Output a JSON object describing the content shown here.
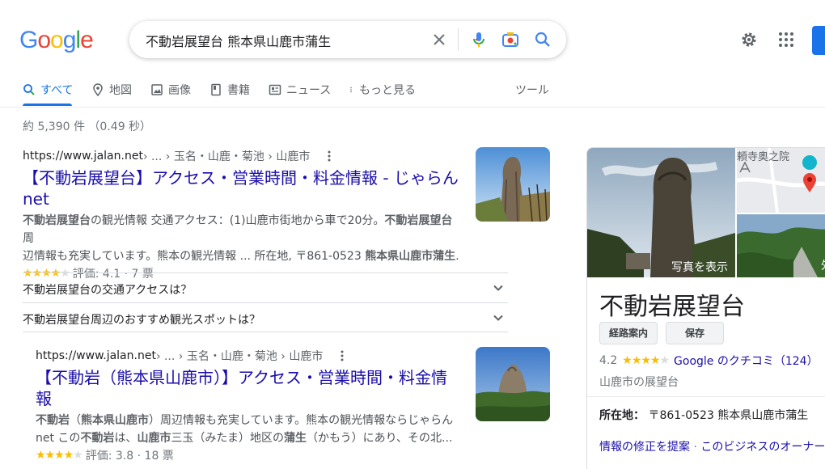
{
  "header": {
    "logo_letters": [
      {
        "ch": "G",
        "color": "#4285F4"
      },
      {
        "ch": "o",
        "color": "#EA4335"
      },
      {
        "ch": "o",
        "color": "#FBBC05"
      },
      {
        "ch": "g",
        "color": "#4285F4"
      },
      {
        "ch": "l",
        "color": "#34A853"
      },
      {
        "ch": "e",
        "color": "#EA4335"
      }
    ],
    "query": "不動岩展望台 熊本県山鹿市蒲生"
  },
  "tabs": [
    {
      "label": "すべて",
      "icon": "search-icon",
      "active": true
    },
    {
      "label": "地図",
      "icon": "map-pin-icon"
    },
    {
      "label": "画像",
      "icon": "image-icon"
    },
    {
      "label": "書籍",
      "icon": "book-icon"
    },
    {
      "label": "ニュース",
      "icon": "news-icon"
    },
    {
      "label": "もっと見る",
      "icon": "more-vert-icon"
    }
  ],
  "tools_label": "ツール",
  "stats": "約 5,390 件 （0.49 秒）",
  "results": [
    {
      "domain": "https://www.jalan.net",
      "path": " › ... › 玉名・山鹿・菊池 › 山鹿市",
      "title_line1": "【不動岩展望台】アクセス・営業時間・料金情報 - じゃらん",
      "title_line2": "net",
      "snippet_line1": [
        {
          "t": "不動岩展望台",
          "b": true
        },
        {
          "t": "の観光情報 交通アクセス：(1)山鹿市街地から車で20分。",
          "b": false
        },
        {
          "t": "不動岩展望台",
          "b": true
        },
        {
          "t": "周",
          "b": false
        }
      ],
      "snippet_line2": [
        {
          "t": "辺情報も充実しています。熊本の観光情報 ... 所在地, 〒861-0523 ",
          "b": false
        },
        {
          "t": "熊本県山鹿市蒲生",
          "b": true
        },
        {
          "t": ".",
          "b": false
        }
      ],
      "rating_text": "評価: 4.1 · 7 票",
      "rating_value": 4.1
    },
    {
      "domain": "https://www.jalan.net",
      "path": " › ... › 玉名・山鹿・菊池 › 山鹿市",
      "title_line1": "【不動岩（熊本県山鹿市）】アクセス・営業時間・料金情",
      "title_line2": "報",
      "snippet_line1": [
        {
          "t": "不動岩",
          "b": true
        },
        {
          "t": "（",
          "b": false
        },
        {
          "t": "熊本県山鹿市",
          "b": true
        },
        {
          "t": "）周辺情報も充実しています。熊本の観光情報ならじゃらん",
          "b": false
        }
      ],
      "snippet_line2": [
        {
          "t": "net この",
          "b": false
        },
        {
          "t": "不動岩",
          "b": true
        },
        {
          "t": "は、",
          "b": false
        },
        {
          "t": "山鹿市",
          "b": true
        },
        {
          "t": "三玉（みたま）地区の",
          "b": false
        },
        {
          "t": "蒲生",
          "b": true
        },
        {
          "t": "（かもう）にあり、その北...",
          "b": false
        }
      ],
      "rating_text": "評価: 3.8 · 18 票",
      "rating_value": 3.8
    }
  ],
  "faqs": [
    "不動岩展望台の交通アクセスは？",
    "不動岩展望台周辺のおすすめ観光スポットは？"
  ],
  "knowledge_panel": {
    "photo_label": "写真を表示",
    "map_label": "頼寺奥之院",
    "side_label": "外",
    "title": "不動岩展望台",
    "buttons": [
      "経路案内",
      "保存"
    ],
    "rating": "4.2",
    "rating_value": 4.2,
    "reviews_link": "Google のクチコミ（124）",
    "type": "山鹿市の展望台",
    "address_label": "所在地：",
    "address_value": "〒861-0523 熊本県山鹿市蒲生",
    "link_suggest": "情報の修正を提案",
    "link_sep": " · ",
    "link_owner": "このビジネスのオーナー"
  }
}
